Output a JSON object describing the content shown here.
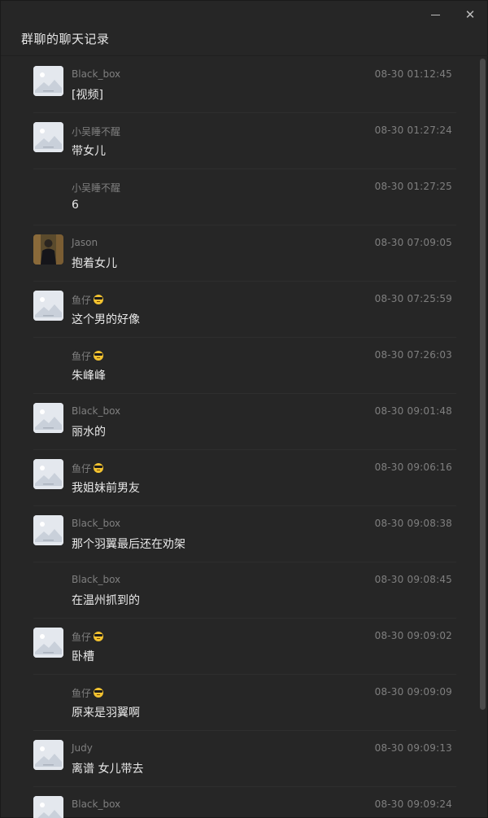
{
  "window": {
    "title": "群聊的聊天记录",
    "minimize_icon": "minimize-icon",
    "close_icon": "close-icon",
    "close_glyph": "✕"
  },
  "messages": [
    {
      "sender": "Black_box",
      "emoji": false,
      "time": "08-30 01:12:45",
      "text": "[视频]",
      "avatar": "placeholder"
    },
    {
      "sender": "小吴睡不醒",
      "emoji": false,
      "time": "08-30 01:27:24",
      "text": "带女儿",
      "avatar": "placeholder"
    },
    {
      "sender": "小吴睡不醒",
      "emoji": false,
      "time": "08-30 01:27:25",
      "text": "6",
      "avatar": "none"
    },
    {
      "sender": "Jason",
      "emoji": false,
      "time": "08-30 07:09:05",
      "text": "抱着女儿",
      "avatar": "photo"
    },
    {
      "sender": "鱼仔",
      "emoji": true,
      "time": "08-30 07:25:59",
      "text": "这个男的好像",
      "avatar": "placeholder"
    },
    {
      "sender": "鱼仔",
      "emoji": true,
      "time": "08-30 07:26:03",
      "text": "朱峰峰",
      "avatar": "none"
    },
    {
      "sender": "Black_box",
      "emoji": false,
      "time": "08-30 09:01:48",
      "text": "丽水的",
      "avatar": "placeholder"
    },
    {
      "sender": "鱼仔",
      "emoji": true,
      "time": "08-30 09:06:16",
      "text": "我姐妹前男友",
      "avatar": "placeholder"
    },
    {
      "sender": "Black_box",
      "emoji": false,
      "time": "08-30 09:08:38",
      "text": "那个羽翼最后还在劝架",
      "avatar": "placeholder"
    },
    {
      "sender": "Black_box",
      "emoji": false,
      "time": "08-30 09:08:45",
      "text": "在温州抓到的",
      "avatar": "none"
    },
    {
      "sender": "鱼仔",
      "emoji": true,
      "time": "08-30 09:09:02",
      "text": "卧槽",
      "avatar": "placeholder"
    },
    {
      "sender": "鱼仔",
      "emoji": true,
      "time": "08-30 09:09:09",
      "text": "原来是羽翼啊",
      "avatar": "none"
    },
    {
      "sender": "Judy",
      "emoji": false,
      "time": "08-30 09:09:13",
      "text": "离谱  女儿带去",
      "avatar": "placeholder"
    },
    {
      "sender": "Black_box",
      "emoji": false,
      "time": "08-30 09:09:24",
      "text": "",
      "avatar": "placeholder"
    }
  ],
  "colors": {
    "background": "#262626",
    "sender_text": "#7f7f7f",
    "message_text": "#e8e8e8",
    "divider": "#2e2e2e"
  }
}
